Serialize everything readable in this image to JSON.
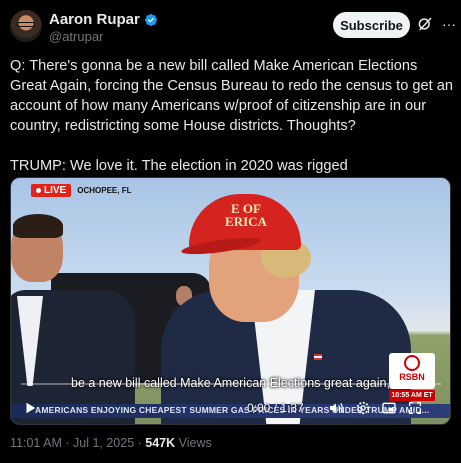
{
  "author": {
    "name": "Aaron Rupar",
    "handle": "@atrupar",
    "verified": true
  },
  "header": {
    "subscribe_label": "Subscribe",
    "more_label": "···"
  },
  "tweet": {
    "paragraph1": "Q: There's gonna be a new bill called Make American Elections Great Again, forcing the Census Bureau to redo the census to get an account of how many Americans w/proof of citizenship are in our country, redistricting some House districts. Thoughts?",
    "paragraph2": "TRUMP: We love it. The election in 2020 was rigged"
  },
  "video": {
    "live_label": "LIVE",
    "location": "OCHOPEE, FL",
    "cap_text": "E OF\nERICA",
    "caption": "be a new bill called Make American Elections great again,",
    "ticker": "AMERICANS ENJOYING CHEAPEST SUMMER GAS PRICES IN YEARS UNDER TRUMP AMID...",
    "rsbn_label": "RSBN",
    "rsbn_time": "10:55 AM ET",
    "time_display": "0:00 / 1:37",
    "progress": 0
  },
  "footer": {
    "timestamp": "11:01 AM · Jul 1, 2025 ·",
    "views_count": "547K",
    "views_label": "Views"
  },
  "colors": {
    "background": "#000000",
    "text": "#e7e9ea",
    "muted": "#71767b",
    "verified": "#1d9bf0",
    "live_red": "#e0241b"
  }
}
